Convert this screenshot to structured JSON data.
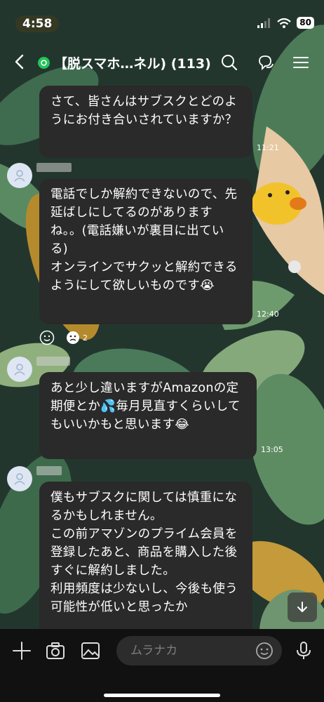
{
  "status": {
    "time": "4:58",
    "battery": "80"
  },
  "header": {
    "title": "【脱スマホ…ネル) (113)"
  },
  "messages": [
    {
      "text": "さて、皆さんはサブスクとどのようにお付き合いされていますか？",
      "time": "11:21"
    },
    {
      "text": "電話でしか解約できないので、先延ばしにしてるのがありますね。。(電話嫌いが裏目に出ている)\nオンラインでサクッと解約できるようにして欲しいものです😭",
      "time": "12:40",
      "reaction_count": "2"
    },
    {
      "text": "あと少し違いますがAmazonの定期便とか💦毎月見直すくらいしてもいいかもと思います😂",
      "time": "13:05"
    },
    {
      "text": "僕もサブスクに関しては慎重になるかもしれません。\nこの前アマゾンのプライム会員を登録したあと、商品を購入した後すぐに解約しました。\n利用頻度は少ないし、今後も使う可能性が低いと思ったか"
    }
  ],
  "input": {
    "placeholder": "ムラナカ"
  },
  "colors": {
    "bubble": "#2a2a2a",
    "bar": "#111111",
    "accent": "#23c45a"
  }
}
